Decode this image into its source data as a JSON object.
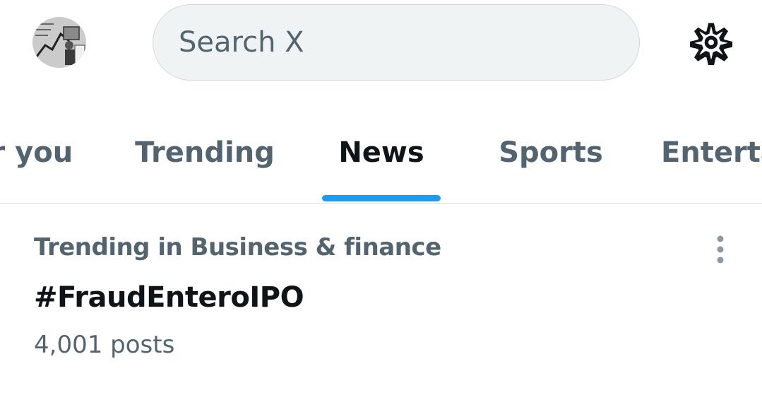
{
  "header": {
    "avatar_icon": "profile-avatar",
    "search_placeholder": "Search X",
    "settings_icon": "gear-icon"
  },
  "tabs": [
    {
      "label": "For you",
      "visible_text": "or you",
      "active": false
    },
    {
      "label": "Trending",
      "active": false
    },
    {
      "label": "News",
      "active": true
    },
    {
      "label": "Sports",
      "active": false
    },
    {
      "label": "Entertainment",
      "visible_text": "Enterta",
      "active": false
    }
  ],
  "trend": {
    "context": "Trending in Business & finance",
    "name": "#FraudEnteroIPO",
    "post_count": "4,001 posts",
    "more_icon": "more-vertical-icon"
  },
  "colors": {
    "accent": "#1d9bf0",
    "primary_text": "#0f1419",
    "secondary_text": "#536471",
    "search_bg": "#eff3f4",
    "divider": "#dadfe3"
  }
}
